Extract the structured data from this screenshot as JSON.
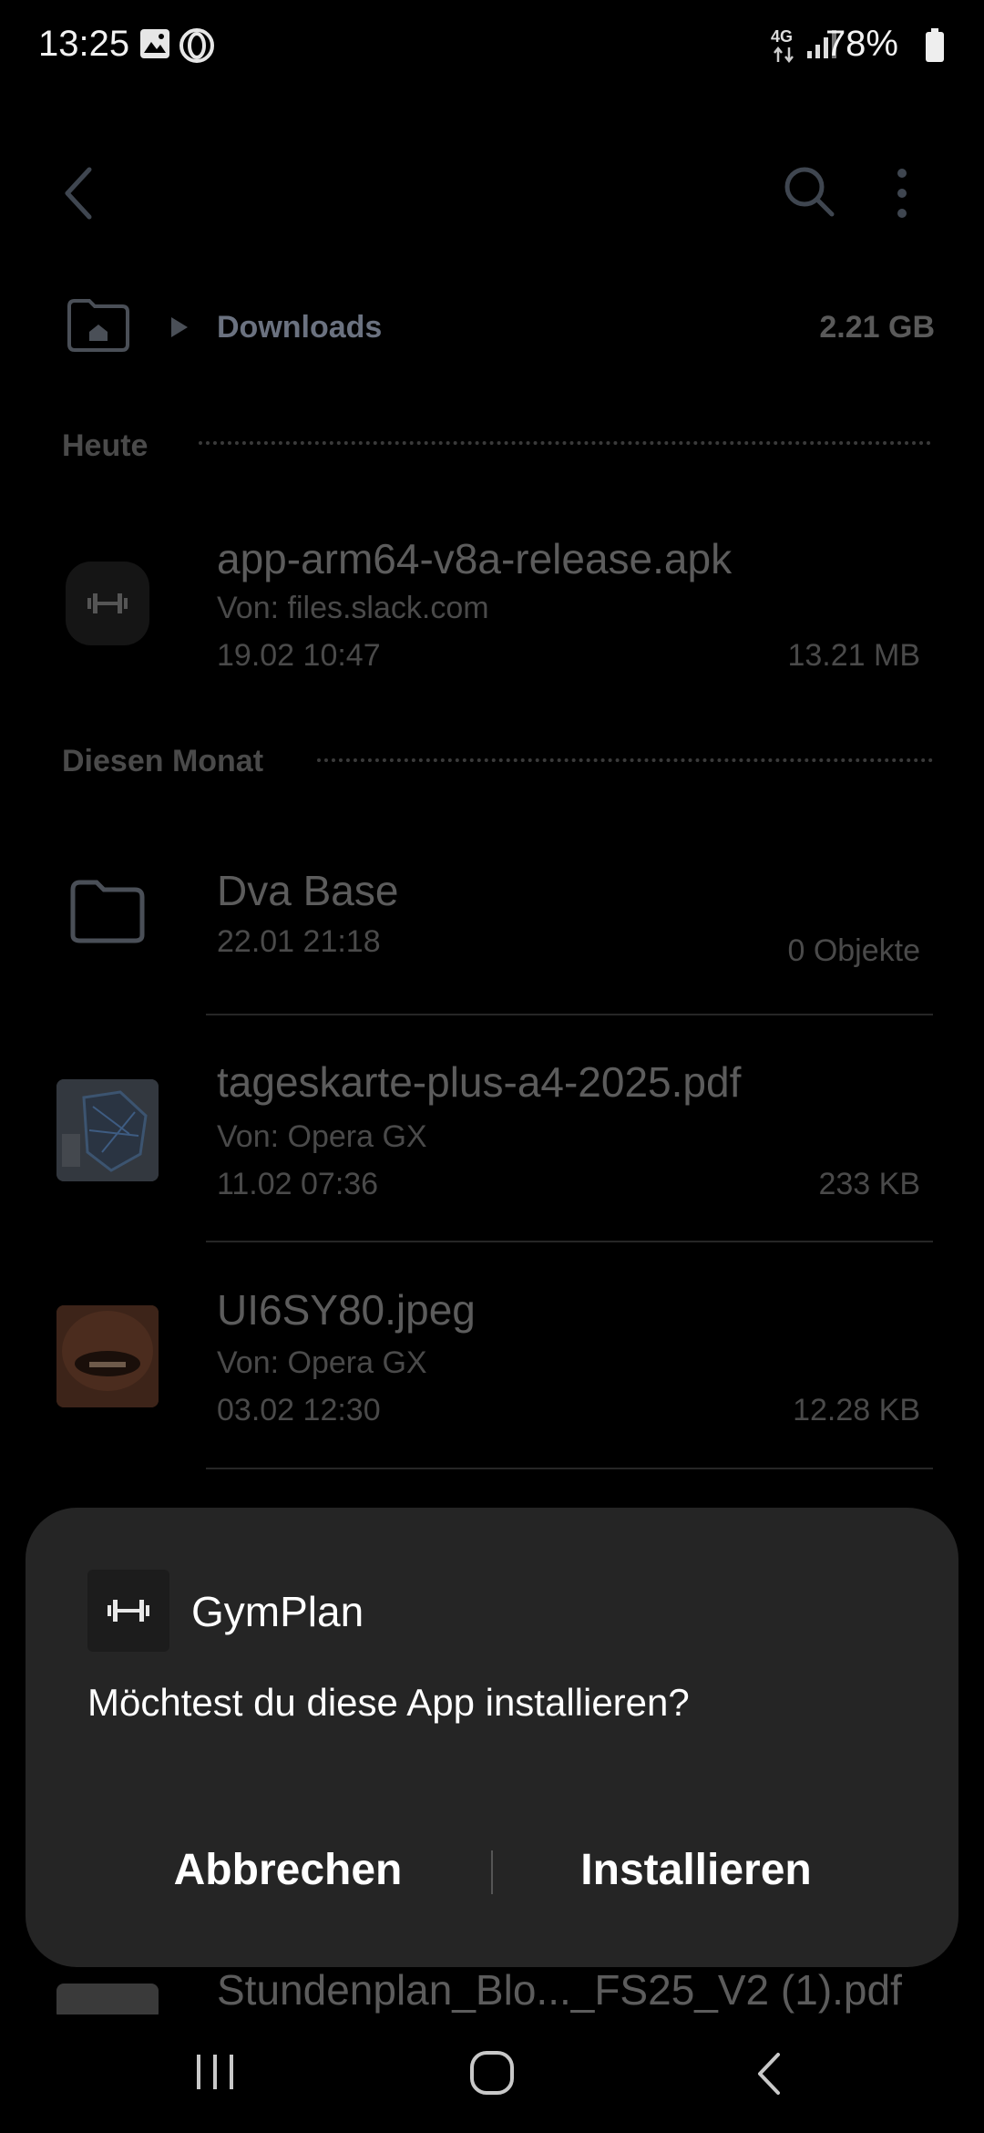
{
  "status_bar": {
    "time": "13:25",
    "network": "4G",
    "battery": "78%"
  },
  "breadcrumb": {
    "folder": "Downloads",
    "size": "2.21 GB"
  },
  "sections": {
    "today": "Heute",
    "this_month": "Diesen Monat"
  },
  "files": [
    {
      "name": "app-arm64-v8a-release.apk",
      "source": "Von: files.slack.com",
      "date": "19.02 10:47",
      "size": "13.21 MB"
    },
    {
      "name": "Dva Base",
      "date": "22.01 21:18",
      "size": "0 Objekte"
    },
    {
      "name": "tageskarte-plus-a4-2025.pdf",
      "source": "Von: Opera GX",
      "date": "11.02 07:36",
      "size": "233 KB"
    },
    {
      "name": "UI6SY80.jpeg",
      "source": "Von: Opera GX",
      "date": "03.02 12:30",
      "size": "12.28 KB"
    },
    {
      "name": "Stundenplan_Blo..._FS25_V2 (1).pdf"
    }
  ],
  "dialog": {
    "app_name": "GymPlan",
    "question": "Möchtest du diese App installieren?",
    "cancel_label": "Abbrechen",
    "install_label": "Installieren"
  },
  "icons": {
    "back": "back-arrow-icon",
    "search": "search-icon",
    "more": "more-vert-icon",
    "home": "home-icon",
    "folder": "folder-icon",
    "app": "dumbbell-icon"
  }
}
